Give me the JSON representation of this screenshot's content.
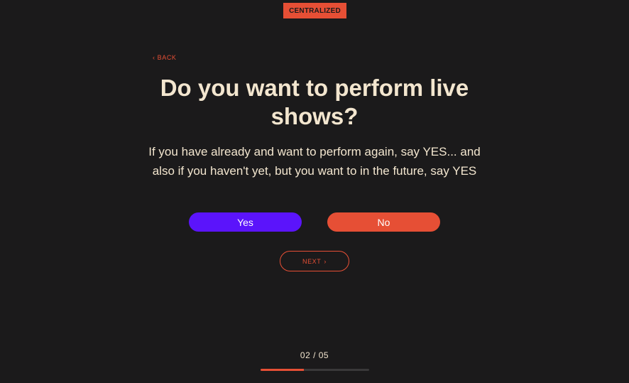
{
  "brand": {
    "logo_text": "CENTRALIZED"
  },
  "nav": {
    "back_chevron": "‹",
    "back_label": "BACK"
  },
  "question": {
    "title": "Do you want to perform live shows?",
    "description": "If you have already and want to perform again, say YES... and also if you haven't yet, but you want to in the future, say YES"
  },
  "answers": {
    "yes_label": "Yes",
    "no_label": "No"
  },
  "next": {
    "label": "NEXT",
    "chevron": "›"
  },
  "progress": {
    "text": "02 / 05",
    "fraction": 0.4
  },
  "colors": {
    "background": "#1b1a1b",
    "accent": "#e64f35",
    "yes_button": "#5b14fb",
    "text": "#f3e6cf",
    "track": "#3a393a"
  }
}
